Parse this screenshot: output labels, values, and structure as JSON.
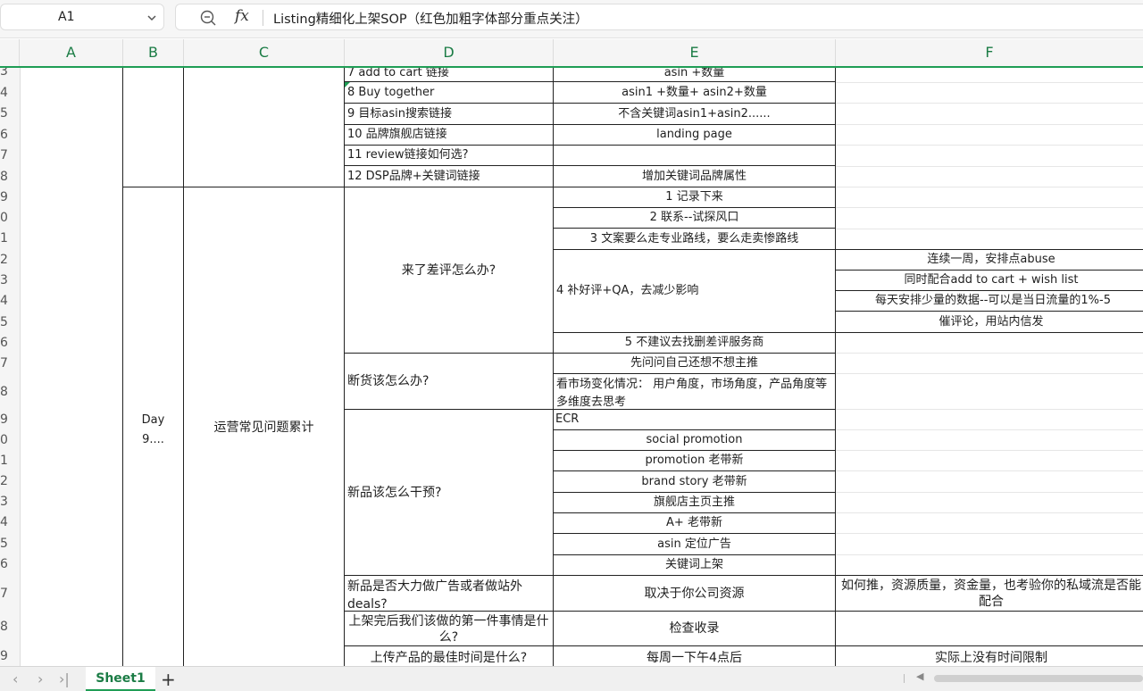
{
  "formula_bar": {
    "cell_ref": "A1",
    "fx_label": "fx",
    "formula_text": "Listing精细化上架SOP（红色加粗字体部分重点关注）"
  },
  "columns": [
    "A",
    "B",
    "C",
    "D",
    "E",
    "F"
  ],
  "row_numbers": [
    "3",
    "4",
    "5",
    "6",
    "7",
    "8",
    "9",
    "0",
    "1",
    "2",
    "3",
    "4",
    "5",
    "6",
    "7",
    "8",
    "9",
    "0",
    "1",
    "2",
    "3",
    "4",
    "5",
    "6",
    "7",
    "8",
    "9"
  ],
  "cells": {
    "d3": "7 add to cart 链接",
    "e3": "asin +数量",
    "d4": "8 Buy together",
    "e4": "asin1 +数量+ asin2+数量",
    "d5": "9 目标asin搜索链接",
    "e5": "不含关键词asin1+asin2......",
    "d6": "10 品牌旗舰店链接",
    "e6": "landing page",
    "d7": "11 review链接如何选?",
    "d8": "12 DSP品牌+关键词链接",
    "e8": "增加关键词品牌属性",
    "b_day": "Day",
    "b_day2": "9....",
    "c_topic": "运营常见问题累计",
    "d_bad_review": "来了差评怎么办?",
    "e9": "1 记录下来",
    "e10": "2 联系--试探风口",
    "e11": "3 文案要么走专业路线，要么走卖惨路线",
    "e12": "4 补好评+QA，去减少影响",
    "f12": "连续一周，安排点abuse",
    "f13": "同时配合add to cart + wish list",
    "f14": "每天安排少量的数据--可以是当日流量的1%-5",
    "f15": "催评论，用站内信发",
    "e16": "5 不建议去找删差评服务商",
    "d_stockout": "断货该怎么办?",
    "e17": "先问问自己还想不想主推",
    "e18": "看市场变化情况： 用户角度，市场角度，产品角度等多维度去思考",
    "d_newproduct": "新品该怎么干预?",
    "e19": "ECR",
    "e20": "social promotion",
    "e21": "promotion 老带新",
    "e22": "brand story 老带新",
    "e23": "旗舰店主页主推",
    "e24": "A+ 老带新",
    "e25": "asin 定位广告",
    "e26": "关键词上架",
    "d27": "新品是否大力做广告或者做站外deals?",
    "e27": "取决于你公司资源",
    "f27": "如何推，资源质量，资金量，也考验你的私域流是否能配合",
    "d28": "上架完后我们该做的第一件事情是什么?",
    "e28": "检查收录",
    "d29": "上传产品的最佳时间是什么?",
    "e29": "每周一下午4点后",
    "f29": "实际上没有时间限制"
  },
  "tabs": {
    "sheet1": "Sheet1",
    "add": "+"
  },
  "colors": {
    "accent": "#1f9d55",
    "header_text": "#1b7c45"
  }
}
